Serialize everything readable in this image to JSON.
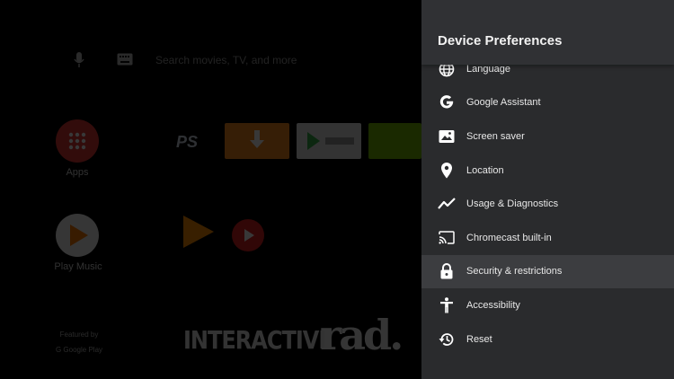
{
  "home": {
    "search_placeholder": "Search movies, TV, and more",
    "apps_label": "Apps",
    "play_music_label": "Play Music",
    "ps_logo": "PS",
    "featured_line1": "Featured by",
    "featured_line2": "G  Google Play",
    "interactive_tile": "INTERACTIVE",
    "rad_tile": "rad."
  },
  "panel": {
    "title": "Device Preferences",
    "items": [
      {
        "label": "Language",
        "icon": "globe-icon"
      },
      {
        "label": "Google Assistant",
        "icon": "google-g-icon"
      },
      {
        "label": "Screen saver",
        "icon": "screen-saver-icon"
      },
      {
        "label": "Location",
        "icon": "location-pin-icon"
      },
      {
        "label": "Usage & Diagnostics",
        "icon": "trend-line-icon"
      },
      {
        "label": "Chromecast built-in",
        "icon": "cast-icon"
      },
      {
        "label": "Security & restrictions",
        "icon": "lock-icon"
      },
      {
        "label": "Accessibility",
        "icon": "accessibility-icon"
      },
      {
        "label": "Reset",
        "icon": "reset-history-icon"
      }
    ],
    "selected_index": 6
  },
  "colors": {
    "panel_bg": "#2a2b2d",
    "panel_header_bg": "#303134",
    "selected_row_bg": "#3c3d40",
    "text": "#e8e8e8"
  }
}
